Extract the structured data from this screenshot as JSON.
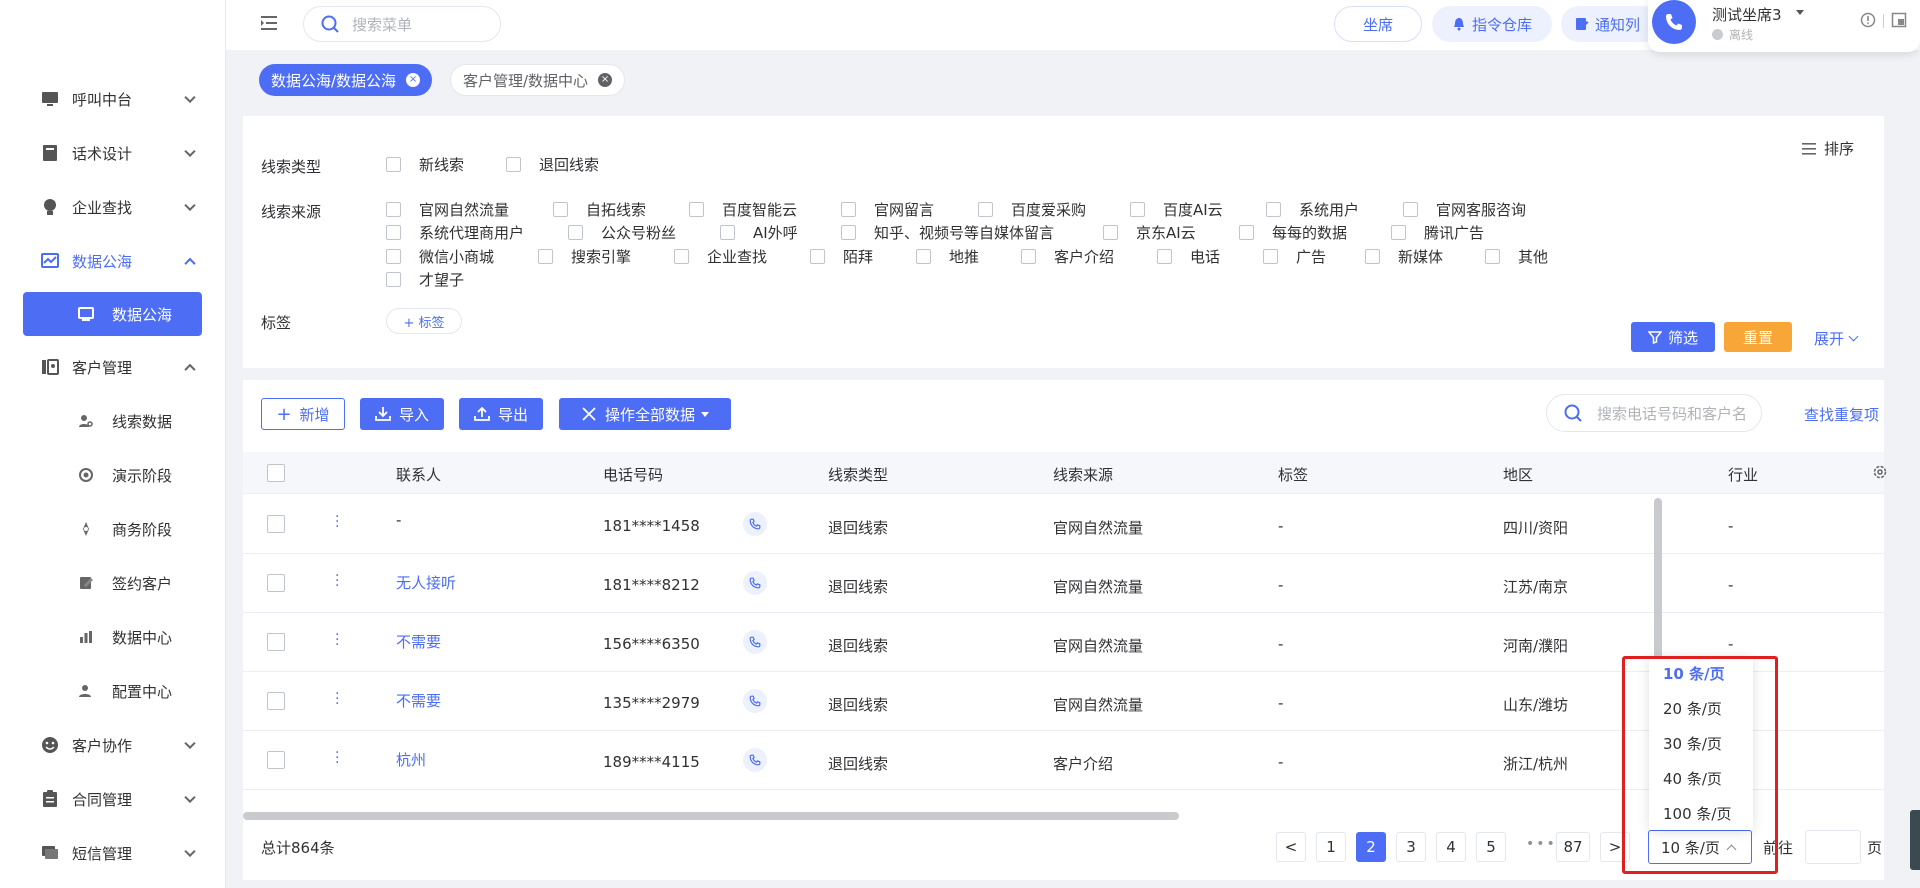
{
  "topbar": {
    "search_placeholder": "搜索菜单",
    "seat_label": "坐席",
    "command_label": "指令仓库",
    "notice_label": "通知列",
    "agent_name": "测试坐席3",
    "agent_status": "离线"
  },
  "sidebar": {
    "items": [
      {
        "label": "呼叫中台"
      },
      {
        "label": "话术设计"
      },
      {
        "label": "企业查找"
      },
      {
        "label": "数据公海"
      },
      {
        "label": "数据公海"
      },
      {
        "label": "客户管理"
      },
      {
        "label": "线索数据"
      },
      {
        "label": "演示阶段"
      },
      {
        "label": "商务阶段"
      },
      {
        "label": "签约客户"
      },
      {
        "label": "数据中心"
      },
      {
        "label": "配置中心"
      },
      {
        "label": "客户协作"
      },
      {
        "label": "合同管理"
      },
      {
        "label": "短信管理"
      }
    ]
  },
  "tabs": [
    {
      "label": "数据公海/数据公海",
      "close": "×"
    },
    {
      "label": "客户管理/数据中心",
      "close": "×"
    }
  ],
  "filters": {
    "clue_type_label": "线索类型",
    "clue_types": [
      "新线索",
      "退回线索"
    ],
    "clue_source_label": "线索来源",
    "clue_sources": [
      "官网自然流量",
      "自拓线索",
      "百度智能云",
      "官网留言",
      "百度爱采购",
      "百度AI云",
      "系统用户",
      "官网客服咨询",
      "系统代理商用户",
      "公众号粉丝",
      "AI外呼",
      "知乎、视频号等自媒体留言",
      "京东AI云",
      "每每的数据",
      "腾讯广告",
      "微信小商城",
      "搜索引擎",
      "企业查找",
      "陌拜",
      "地推",
      "客户介绍",
      "电话",
      "广告",
      "新媒体",
      "其他",
      "才望子"
    ],
    "tag_label": "标签",
    "add_tag_label": "+ 标签",
    "sort_label": "排序",
    "filter_button": "筛选",
    "reset_button": "重置",
    "expand_button": "展开"
  },
  "toolbar": {
    "add_label": "新增",
    "import_label": "导入",
    "export_label": "导出",
    "operate_all_label": "操作全部数据",
    "search_placeholder": "搜索电话号码和客户名",
    "find_duplicate_label": "查找重复项"
  },
  "table": {
    "columns": [
      "联系人",
      "电话号码",
      "线索类型",
      "线索来源",
      "标签",
      "地区",
      "行业"
    ],
    "rows": [
      {
        "contact": "-",
        "phone": "181****1458",
        "type": "退回线索",
        "source": "官网自然流量",
        "tag": "-",
        "region": "四川/资阳",
        "industry": "-"
      },
      {
        "contact": "无人接听",
        "phone": "181****8212",
        "type": "退回线索",
        "source": "官网自然流量",
        "tag": "-",
        "region": "江苏/南京",
        "industry": "-"
      },
      {
        "contact": "不需要",
        "phone": "156****6350",
        "type": "退回线索",
        "source": "官网自然流量",
        "tag": "-",
        "region": "河南/濮阳",
        "industry": "-"
      },
      {
        "contact": "不需要",
        "phone": "135****2979",
        "type": "退回线索",
        "source": "官网自然流量",
        "tag": "-",
        "region": "山东/潍坊",
        "industry": ""
      },
      {
        "contact": "杭州",
        "phone": "189****4115",
        "type": "退回线索",
        "source": "客户介绍",
        "tag": "-",
        "region": "浙江/杭州",
        "industry": ""
      }
    ]
  },
  "pagination": {
    "total": "总计864条",
    "pages": [
      "1",
      "2",
      "3",
      "4",
      "5",
      "87"
    ],
    "current": "2",
    "more": "•••",
    "prev": "<",
    "next": ">",
    "page_size": "10 条/页",
    "goto_label": "前往",
    "goto_unit": "页",
    "size_options": [
      "10 条/页",
      "20 条/页",
      "30 条/页",
      "40 条/页",
      "100 条/页"
    ]
  },
  "colors": {
    "primary": "#4d6ef4",
    "warning": "#f7a637",
    "highlight": "#e02020"
  }
}
